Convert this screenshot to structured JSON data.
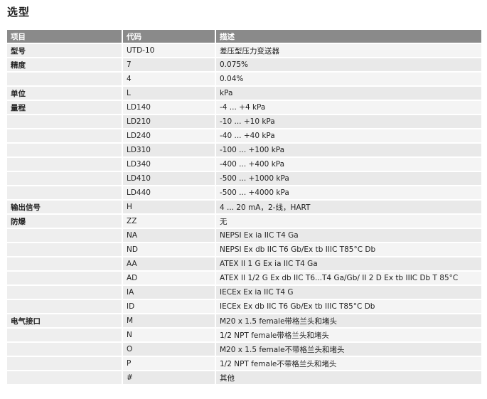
{
  "title": "选型",
  "headers": [
    "项目",
    "代码",
    "描述"
  ],
  "rows": [
    {
      "category": "型号",
      "code": "UTD-10",
      "desc": "差压型压力变送器"
    },
    {
      "category": "精度",
      "code": "7",
      "desc": "0.075%"
    },
    {
      "category": "",
      "code": "4",
      "desc": "0.04%"
    },
    {
      "category": "单位",
      "code": "L",
      "desc": "kPa"
    },
    {
      "category": "量程",
      "code": "LD140",
      "desc": "-4 ... +4 kPa"
    },
    {
      "category": "",
      "code": "LD210",
      "desc": "-10 ... +10 kPa"
    },
    {
      "category": "",
      "code": "LD240",
      "desc": "-40 ... +40 kPa"
    },
    {
      "category": "",
      "code": "LD310",
      "desc": "-100 ... +100 kPa"
    },
    {
      "category": "",
      "code": "LD340",
      "desc": "-400 ... +400 kPa"
    },
    {
      "category": "",
      "code": "LD410",
      "desc": "-500 ... +1000 kPa"
    },
    {
      "category": "",
      "code": "LD440",
      "desc": "-500 ... +4000 kPa"
    },
    {
      "category": "输出信号",
      "code": "H",
      "desc": "4 ... 20 mA，2-线，HART"
    },
    {
      "category": "防爆",
      "code": "ZZ",
      "desc": "无"
    },
    {
      "category": "",
      "code": "NA",
      "desc": "NEPSI Ex ia IIC T4 Ga"
    },
    {
      "category": "",
      "code": "ND",
      "desc": "NEPSI Ex db IIC T6 Gb/Ex tb IIIC T85°C Db"
    },
    {
      "category": "",
      "code": "AA",
      "desc": "ATEX II 1 G Ex ia IIC T4 Ga"
    },
    {
      "category": "",
      "code": "AD",
      "desc": "ATEX II 1/2 G Ex db IIC T6...T4 Ga/Gb/ II 2 D Ex tb IIIC Db T 85°C"
    },
    {
      "category": "",
      "code": "IA",
      "desc": "IECEx Ex ia IIC T4 G"
    },
    {
      "category": "",
      "code": "ID",
      "desc": "IECEx Ex db IIC T6 Gb/Ex tb IIIC T85°C Db"
    },
    {
      "category": "电气接口",
      "code": "M",
      "desc": "M20 x 1.5 female带格兰头和堵头"
    },
    {
      "category": "",
      "code": "N",
      "desc": "1/2 NPT female带格兰头和堵头"
    },
    {
      "category": "",
      "code": "O",
      "desc": "M20 x 1.5 female不带格兰头和堵头"
    },
    {
      "category": "",
      "code": "P",
      "desc": "1/2 NPT female不带格兰头和堵头"
    },
    {
      "category": "",
      "code": "#",
      "desc": "其他"
    }
  ]
}
